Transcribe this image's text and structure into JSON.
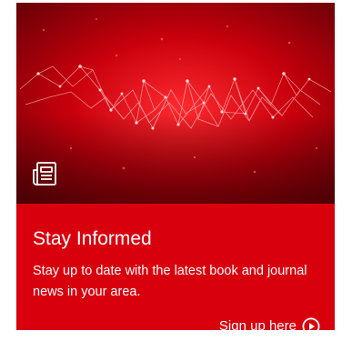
{
  "card": {
    "title": "Stay Informed",
    "description": "Stay up to date with the latest book and journal news in your area.",
    "cta_label": "Sign up here",
    "icons": {
      "hero": "newspaper-icon",
      "cta": "play-circle-icon"
    },
    "colors": {
      "card_background": "#d9000d",
      "hero_dark": "#5a0006",
      "hero_glow": "#ff2a2f",
      "text": "#ffffff"
    }
  }
}
